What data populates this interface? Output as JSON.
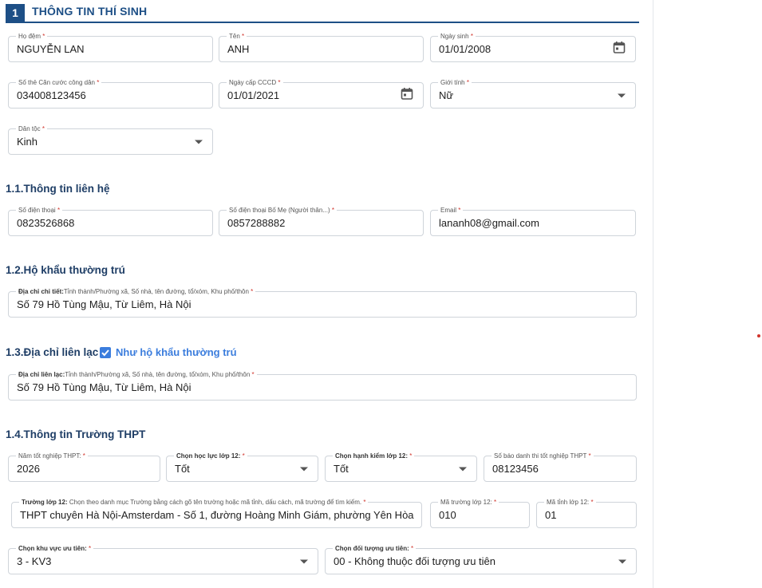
{
  "section": {
    "number": "1",
    "title": "THÔNG TIN THÍ SINH"
  },
  "fields": {
    "ho_dem": {
      "label": "Họ đệm",
      "value": "NGUYỄN LAN"
    },
    "ten": {
      "label": "Tên",
      "value": "ANH"
    },
    "ngay_sinh": {
      "label": "Ngày sinh",
      "value": "01/01/2008"
    },
    "so_the_cccd": {
      "label": "Số thẻ Căn cước công dân",
      "value": "034008123456"
    },
    "ngay_cap_cccd": {
      "label": "Ngày cấp CCCD",
      "value": "01/01/2021"
    },
    "gioi_tinh": {
      "label": "Giới tính",
      "value": "Nữ"
    },
    "dan_toc": {
      "label": "Dân tộc",
      "value": "Kinh"
    }
  },
  "contact": {
    "heading": "1.1.Thông tin liên hệ",
    "phone": {
      "label": "Số điện thoại",
      "value": "0823526868"
    },
    "parent_phone": {
      "label": "Số điện thoại Bố Mẹ (Người thân...)",
      "value": "0857288882"
    },
    "email": {
      "label": "Email",
      "value": "lananh08@gmail.com"
    }
  },
  "ho_khau": {
    "heading": "1.2.Hộ khẩu thường trú",
    "address": {
      "label_bold": "Địa chỉ chi tiết:",
      "label_rest": "Tỉnh thành/Phường xã, Số nhà, tên đường, tổ/xóm, Khu phố/thôn",
      "value": "Số 79 Hồ Tùng Mậu, Từ Liêm, Hà Nội"
    }
  },
  "lien_lac": {
    "heading": "1.3.Địa chỉ liên lạc",
    "same_as_checkbox": "Như hộ khẩu thường trú",
    "address": {
      "label_bold": "Địa chỉ liên lạc:",
      "label_rest": "Tỉnh thành/Phường xã, Số nhà, tên đường, tổ/xóm, Khu phố/thôn",
      "value": "Số 79 Hồ Tùng Mậu, Từ Liêm, Hà Nội"
    }
  },
  "school": {
    "heading": "1.4.Thông tin Trường THPT",
    "nam_tot_nghiep": {
      "label": "Năm tốt nghiệp THPT:",
      "value": "2026"
    },
    "hoc_luc": {
      "label": "Chọn học lực lớp 12:",
      "value": "Tốt"
    },
    "hanh_kiem": {
      "label": "Chọn hạnh kiểm lớp 12:",
      "value": "Tốt"
    },
    "so_bao_danh": {
      "label": "Số báo danh thi tốt nghiệp THPT",
      "value": "08123456"
    },
    "truong": {
      "label_bold": "Trường lớp 12:",
      "label_rest": "Chọn theo danh mục Trường bằng cách gõ tên trường hoặc mã tỉnh, dấu cách, mã trường để tìm kiếm.",
      "value": "THPT chuyên Hà Nội-Amsterdam - Số 1, đường Hoàng Minh Giám, phường Yên Hòa"
    },
    "ma_truong": {
      "label": "Mã trường lớp 12:",
      "value": "010"
    },
    "ma_tinh": {
      "label": "Mã tỉnh lớp 12:",
      "value": "01"
    },
    "khu_vuc": {
      "label": "Chọn khu vực ưu tiên:",
      "value": "3 - KV3"
    },
    "doi_tuong": {
      "label": "Chọn đối tượng ưu tiên:",
      "value": "00 - Không thuộc đối tượng ưu tiên"
    }
  },
  "required_mark": "*"
}
